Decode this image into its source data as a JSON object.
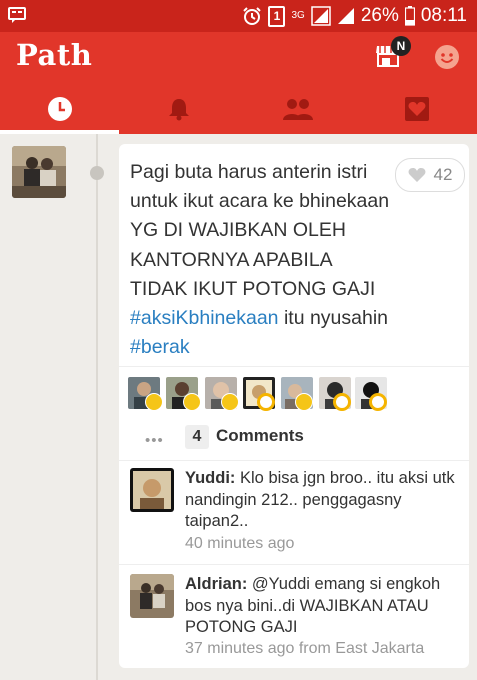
{
  "status_bar": {
    "sim_label": "1",
    "network": "3G",
    "battery": "26%",
    "time": "08:11"
  },
  "header": {
    "logo": "Path",
    "notification_badge": "N"
  },
  "tabs": [
    {
      "icon": "clock-icon",
      "active": true
    },
    {
      "icon": "bell-icon",
      "active": false
    },
    {
      "icon": "friends-icon",
      "active": false
    },
    {
      "icon": "heart-icon",
      "active": false
    }
  ],
  "post": {
    "text_plain": "Pagi buta harus anterin istri untuk ikut acara ke bhinekaan YG DI WAJIBKAN OLEH KANTORNYA APABILA TIDAK IKUT POTONG GAJI ",
    "hashtag_1": "#aksiKbhinekaan",
    "text_mid": " itu nyusahin ",
    "hashtag_2": "#berak",
    "love_count": "42"
  },
  "comments_header": {
    "more": "•••",
    "count": "4",
    "label": "Comments"
  },
  "comments": [
    {
      "name": "Yuddi:",
      "text": " Klo bisa jgn broo.. itu aksi utk nandingin 212.. penggagasny taipan2..",
      "time": "40 minutes ago"
    },
    {
      "name": "Aldrian:",
      "text": " @Yuddi emang si engkoh bos nya bini..di WAJIBKAN ATAU POTONG GAJI",
      "time": "37 minutes ago from East Jakarta"
    }
  ],
  "colors": {
    "header_red": "#e1362a",
    "status_red": "#c9241b",
    "hashtag_blue": "#2a7fc1"
  }
}
